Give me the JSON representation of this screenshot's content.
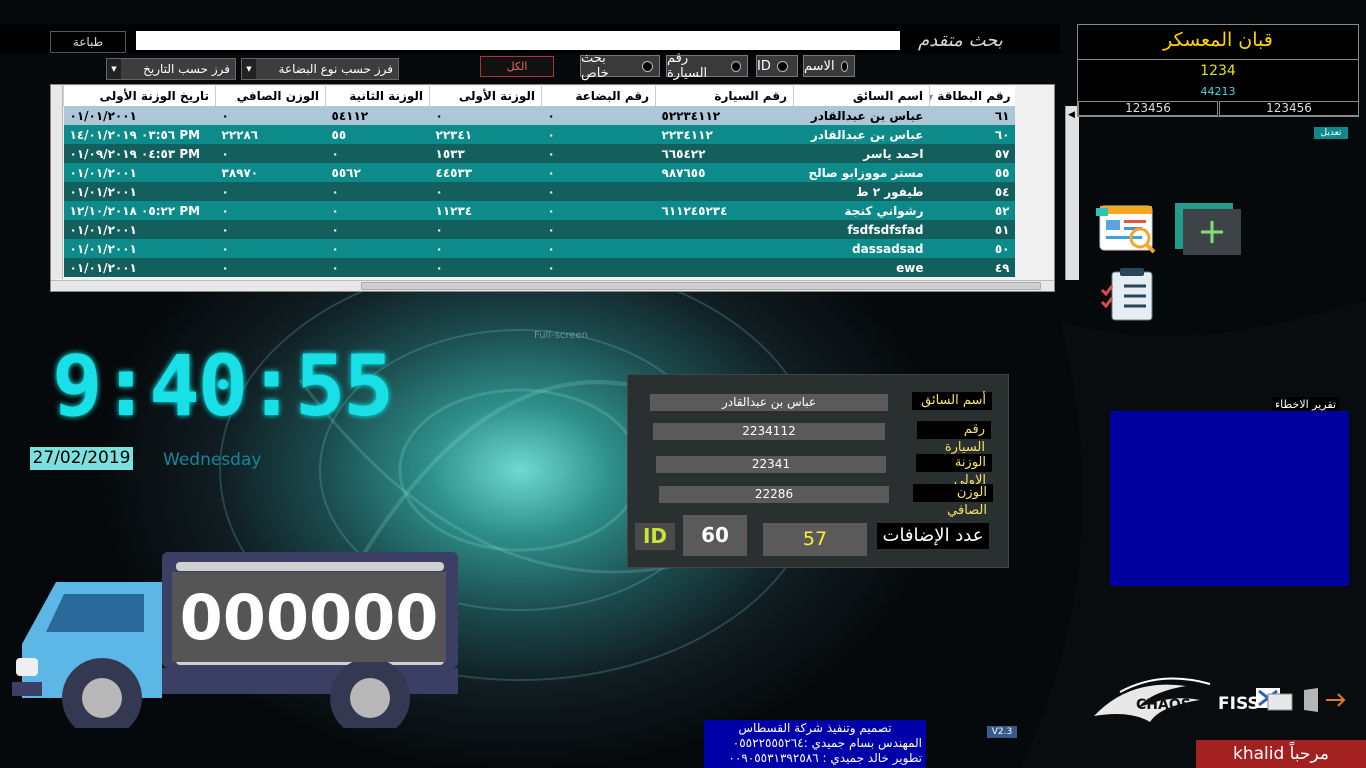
{
  "toolbar": {
    "print_label": "طباعة",
    "search_value": "",
    "advanced_search_label": "بحث متقدم",
    "all_button": "الكل"
  },
  "filters": {
    "radios": [
      "الاسم",
      "ID",
      "رقم السيارة",
      "بحث خاص"
    ],
    "sort_by_goods": "فرز حسب نوع البضاعة",
    "sort_by_date": "فرز حسب التاريخ"
  },
  "table": {
    "columns": [
      "رقم البطاقة",
      "اسم السائق",
      "رقم السيارة",
      "رقم البضاعة",
      "الوزنة الأولى",
      "الوزنة الثانية",
      "الوزن الصافي",
      "تاريخ الوزنة الأولى"
    ],
    "rows": [
      [
        "٦١",
        "عباس بن عبدالقادر",
        "٥٢٢٣٤١١٢",
        "٠",
        "٠",
        "٥٤١١٢",
        "٠",
        "٠١/٠١/٢٠٠١"
      ],
      [
        "٦٠",
        "عباس بن عبدالقادر",
        "٢٢٣٤١١٢",
        "٠",
        "٢٢٣٤١",
        "٥٥",
        "٢٢٢٨٦",
        "PM ٠٣:٥٦ ١٤/٠١/٢٠١٩"
      ],
      [
        "٥٧",
        "احمد ياسر",
        "٦٦٥٤٢٢",
        "٠",
        "١٥٣٣",
        "٠",
        "٠",
        "PM ٠٤:٥٣ ٠١/٠٩/٢٠١٩"
      ],
      [
        "٥٥",
        "مستر مووزابو صالح",
        "٩٨٧٦٥٥",
        "٠",
        "٤٤٥٣٣",
        "٥٥٦٢",
        "٣٨٩٧٠",
        "٠١/٠١/٢٠٠١"
      ],
      [
        "٥٤",
        "طيفور ٢ ط",
        "",
        "٠",
        "٠",
        "٠",
        "٠",
        "٠١/٠١/٢٠٠١"
      ],
      [
        "٥٢",
        "رشواني كنجة",
        "٦١١٢٤٥٢٣٤",
        "٠",
        "١١٢٣٤",
        "٠",
        "٠",
        "PM ٠٥:٢٢ ١٢/١٠/٢٠١٨"
      ],
      [
        "٥١",
        "fsdfsdfsfad",
        "",
        "٠",
        "٠",
        "٠",
        "٠",
        "٠١/٠١/٢٠٠١"
      ],
      [
        "٥٠",
        "dassadsad",
        "",
        "٠",
        "٠",
        "٠",
        "٠",
        "٠١/٠١/٢٠٠١"
      ],
      [
        "٤٩",
        "ewe",
        "",
        "٠",
        "٠",
        "٠",
        "٠",
        "٠١/٠١/٢٠٠١"
      ]
    ]
  },
  "scale": {
    "title": "قبان المعسكر",
    "value1": "1234",
    "value2": "44213",
    "cell_left": "123456",
    "cell_right": "123456",
    "edit_label": "تعديل"
  },
  "clock": {
    "time": "9:40:55",
    "date": "27/02/2019",
    "day": "Wednesday",
    "watermark": "Full-screen"
  },
  "details": {
    "driver_label": "أسم السائق",
    "driver_value": "عباس بن عبدالقادر",
    "car_label": "رقم السيارة",
    "car_value": "2234112",
    "first_weight_label": "الوزنة الاولى",
    "first_weight_value": "22341",
    "net_weight_label": "الوزن الصافي",
    "net_weight_value": "22286",
    "id_label": "ID",
    "id_value": "60",
    "count_value": "57",
    "count_label": "عدد الإضافات"
  },
  "errors": {
    "label": "تقرير الاخطاء"
  },
  "truck": {
    "counter": "000000"
  },
  "footer": {
    "credit_line1": "تصميم وتنفيذ شركة القسطاس",
    "credit_line2": "المهندس بسام جميدي :٠٥٥٢٢٥٥٥٢٦٤",
    "credit_line3": "تطوير خالد جميدي : ٠٠٩٠٥٥٣١٣٩٢٥٨٦",
    "version": "V2.3",
    "logo_text": "CHAOS",
    "logo_text2": "FISS",
    "welcome": "مرحباً khalid"
  },
  "colors": {
    "teal_row": "#0d8b8b",
    "dark_teal_row": "#125f5e",
    "selected_row": "#adc7d7",
    "clock": "#19dfe6",
    "error_box": "#0000a0",
    "welcome_bg": "#a32020"
  }
}
